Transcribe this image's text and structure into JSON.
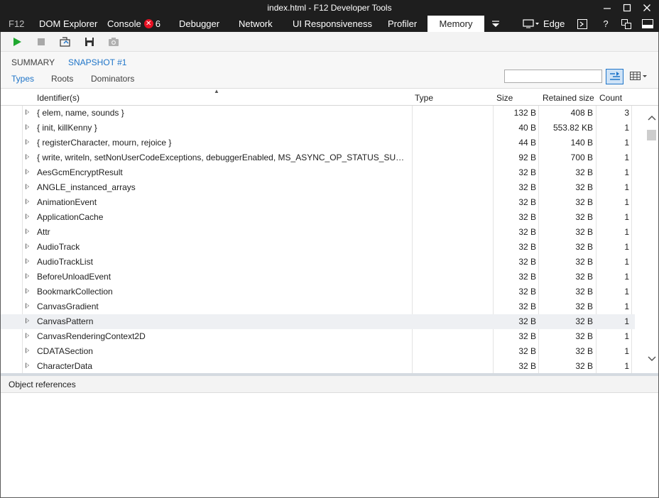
{
  "window": {
    "title": "index.html - F12 Developer Tools",
    "minimize": "—",
    "maximize": "☐",
    "close": "✕"
  },
  "tabs": [
    {
      "label": "F12"
    },
    {
      "label": "DOM Explorer"
    },
    {
      "label": "Console",
      "badge": "✕",
      "count": "6"
    },
    {
      "label": "Debugger"
    },
    {
      "label": "Network"
    },
    {
      "label": "UI Responsiveness"
    },
    {
      "label": "Profiler"
    },
    {
      "label": "Memory",
      "active": true
    }
  ],
  "tab_tools": {
    "overflow_icon": "⯆",
    "emulation_label": "Edge",
    "help_icon": "?"
  },
  "colors": {
    "titlebar": "#1e1e1e",
    "accent_blue": "#1e74c8",
    "play_green": "#1fa82f",
    "hover_row": "#eef0f3"
  },
  "subtabs": {
    "summary": "SUMMARY",
    "snapshot": "SNAPSHOT #1",
    "types": "Types",
    "roots": "Roots",
    "dominators": "Dominators"
  },
  "search": {
    "value": "",
    "placeholder": ""
  },
  "table": {
    "headers": {
      "identifier": "Identifier(s)",
      "type": "Type",
      "size": "Size",
      "retained": "Retained size",
      "count": "Count"
    },
    "sorted_by": "Identifier(s)",
    "rows": [
      {
        "id": "{ elem, name, sounds }",
        "type": "",
        "size": "132 B",
        "retained": "408 B",
        "count": "3"
      },
      {
        "id": "{ init, killKenny }",
        "type": "",
        "size": "40 B",
        "retained": "553.82 KB",
        "count": "1"
      },
      {
        "id": "{ registerCharacter, mourn, rejoice }",
        "type": "",
        "size": "44 B",
        "retained": "140 B",
        "count": "1"
      },
      {
        "id": "{ write, writeln, setNonUserCodeExceptions, debuggerEnabled, MS_ASYNC_OP_STATUS_SUCCESS...",
        "type": "",
        "size": "92 B",
        "retained": "700 B",
        "count": "1"
      },
      {
        "id": "AesGcmEncryptResult",
        "type": "",
        "size": "32 B",
        "retained": "32 B",
        "count": "1"
      },
      {
        "id": "ANGLE_instanced_arrays",
        "type": "",
        "size": "32 B",
        "retained": "32 B",
        "count": "1"
      },
      {
        "id": "AnimationEvent",
        "type": "",
        "size": "32 B",
        "retained": "32 B",
        "count": "1"
      },
      {
        "id": "ApplicationCache",
        "type": "",
        "size": "32 B",
        "retained": "32 B",
        "count": "1"
      },
      {
        "id": "Attr",
        "type": "",
        "size": "32 B",
        "retained": "32 B",
        "count": "1"
      },
      {
        "id": "AudioTrack",
        "type": "",
        "size": "32 B",
        "retained": "32 B",
        "count": "1"
      },
      {
        "id": "AudioTrackList",
        "type": "",
        "size": "32 B",
        "retained": "32 B",
        "count": "1"
      },
      {
        "id": "BeforeUnloadEvent",
        "type": "",
        "size": "32 B",
        "retained": "32 B",
        "count": "1"
      },
      {
        "id": "BookmarkCollection",
        "type": "",
        "size": "32 B",
        "retained": "32 B",
        "count": "1"
      },
      {
        "id": "CanvasGradient",
        "type": "",
        "size": "32 B",
        "retained": "32 B",
        "count": "1"
      },
      {
        "id": "CanvasPattern",
        "type": "",
        "size": "32 B",
        "retained": "32 B",
        "count": "1",
        "hover": true
      },
      {
        "id": "CanvasRenderingContext2D",
        "type": "",
        "size": "32 B",
        "retained": "32 B",
        "count": "1"
      },
      {
        "id": "CDATASection",
        "type": "",
        "size": "32 B",
        "retained": "32 B",
        "count": "1"
      },
      {
        "id": "CharacterData",
        "type": "",
        "size": "32 B",
        "retained": "32 B",
        "count": "1"
      }
    ]
  },
  "object_references": {
    "title": "Object references"
  }
}
